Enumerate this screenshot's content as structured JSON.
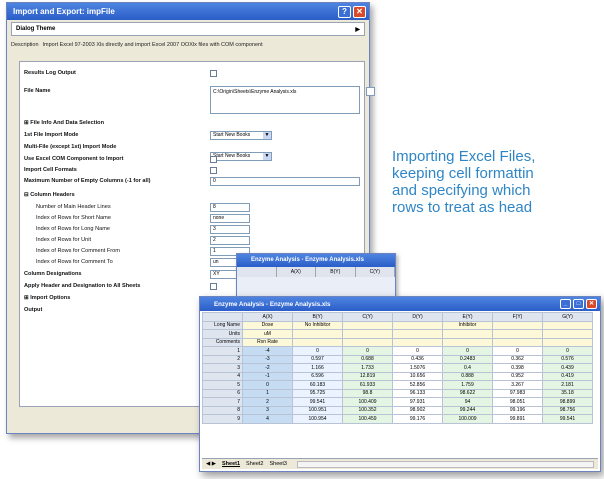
{
  "dialog": {
    "title": "Import and Export: impFile",
    "dialog_theme": "Dialog Theme",
    "description_label": "Description",
    "description": "Import Excel 97-2003 Xls directly and import Excel 2007 OOXlx files with COM component",
    "rows": [
      {
        "label": "Results Log Output",
        "bold": true,
        "control": "checkbox"
      },
      {
        "label": "File Name",
        "bold": true,
        "control": "file",
        "value": "C:\\Origin\\Sheets\\Enzyme Analysis.xls"
      },
      {
        "label": "File Info And Data Selection",
        "bold": true,
        "control": "none",
        "prefix": "⊞"
      },
      {
        "label": "1st File Import Mode",
        "bold": true,
        "control": "dropdown",
        "value": "Start New Books"
      },
      {
        "label": "Multi-File (except 1st) Import Mode",
        "bold": true,
        "control": "dropdown",
        "value": "Start New Books"
      },
      {
        "label": "Use Excel COM Component to Import",
        "bold": true,
        "control": "checkbox"
      },
      {
        "label": "Import Cell Formats",
        "bold": true,
        "control": "checkbox"
      },
      {
        "label": "Maximum Number of Empty Columns (-1 for all)",
        "bold": true,
        "control": "text",
        "value": "0"
      },
      {
        "label": "Column Headers",
        "bold": true,
        "control": "none",
        "prefix": "⊟"
      },
      {
        "label": "Number of Main Header Lines",
        "bold": false,
        "control": "stub",
        "value": "8"
      },
      {
        "label": "Index of Rows for Short Name",
        "bold": false,
        "control": "stub",
        "value": "none"
      },
      {
        "label": "Index of Rows for Long Name",
        "bold": false,
        "control": "stub",
        "value": "3"
      },
      {
        "label": "Index of Rows for Unit",
        "bold": false,
        "control": "stub",
        "value": "2"
      },
      {
        "label": "Index of Rows for Comment From",
        "bold": false,
        "control": "stub",
        "value": "1"
      },
      {
        "label": "Index of Rows for Comment To",
        "bold": false,
        "control": "stub",
        "value": "un"
      },
      {
        "label": "Column Designations",
        "bold": true,
        "control": "stub",
        "value": "XY"
      },
      {
        "label": "Apply Header and Designation to All Sheets",
        "bold": true,
        "control": "checkbox"
      },
      {
        "label": "Import Options",
        "bold": true,
        "control": "none",
        "prefix": "⊞"
      },
      {
        "label": "Output",
        "bold": true,
        "control": "stub",
        "value": "[<"
      }
    ],
    "buttons": {
      "ok": "OK",
      "cancel": "Cancel"
    }
  },
  "caption": {
    "lines": [
      "Importing Excel Files,",
      "keeping cell formattin",
      "and specifying which",
      "rows to treat as head"
    ]
  },
  "back_sheet": {
    "title": "Enzyme Analysis - Enzyme Analysis.xls",
    "headers": [
      "A(X)",
      "B(Y)",
      "C(Y)"
    ]
  },
  "sheet": {
    "title": "Enzyme Analysis - Enzyme Analysis.xls",
    "col_headers": [
      "A(X)",
      "B(Y)",
      "C(Y)",
      "D(Y)",
      "E(Y)",
      "F(Y)",
      "G(Y)"
    ],
    "meta_rows": [
      {
        "name": "Long Name",
        "cells": [
          "Dose",
          "No Inhibitor",
          "",
          "",
          "Inhibitor",
          "",
          ""
        ]
      },
      {
        "name": "Units",
        "cells": [
          "uM",
          "",
          "",
          "",
          "",
          "",
          ""
        ]
      },
      {
        "name": "Comments",
        "cells": [
          "Rxn Rate",
          "",
          "",
          "",
          "",
          "",
          ""
        ]
      }
    ],
    "data_rows": [
      {
        "n": "1",
        "cells": [
          "-4",
          "0",
          "0",
          "0",
          "0",
          "0",
          "0"
        ]
      },
      {
        "n": "2",
        "cells": [
          "-3",
          "0.597",
          "0.688",
          "0.436",
          "0.2483",
          "0.362",
          "0.576"
        ]
      },
      {
        "n": "3",
        "cells": [
          "-2",
          "1.166",
          "1.733",
          "1.5076",
          "0.4",
          "0.398",
          "0.439"
        ]
      },
      {
        "n": "4",
        "cells": [
          "-1",
          "6.596",
          "12.819",
          "10.656",
          "0.888",
          "0.952",
          "0.419"
        ]
      },
      {
        "n": "5",
        "cells": [
          "0",
          "60.183",
          "61.933",
          "52.856",
          "1.759",
          "3.267",
          "2.181"
        ]
      },
      {
        "n": "6",
        "cells": [
          "1",
          "95.725",
          "98.8",
          "96.133",
          "98.622",
          "97.983",
          "35.18"
        ]
      },
      {
        "n": "7",
        "cells": [
          "2",
          "99.541",
          "100.409",
          "97.931",
          "94",
          "98.051",
          "98.899"
        ]
      },
      {
        "n": "8",
        "cells": [
          "3",
          "100.951",
          "100.352",
          "98.902",
          "99.244",
          "99.196",
          "98.756"
        ]
      },
      {
        "n": "9",
        "cells": [
          "4",
          "100.954",
          "100.459",
          "99.176",
          "100.009",
          "99.891",
          "99.541"
        ]
      }
    ],
    "tabs": [
      "Sheet1",
      "Sheet2",
      "Sheet3"
    ]
  }
}
